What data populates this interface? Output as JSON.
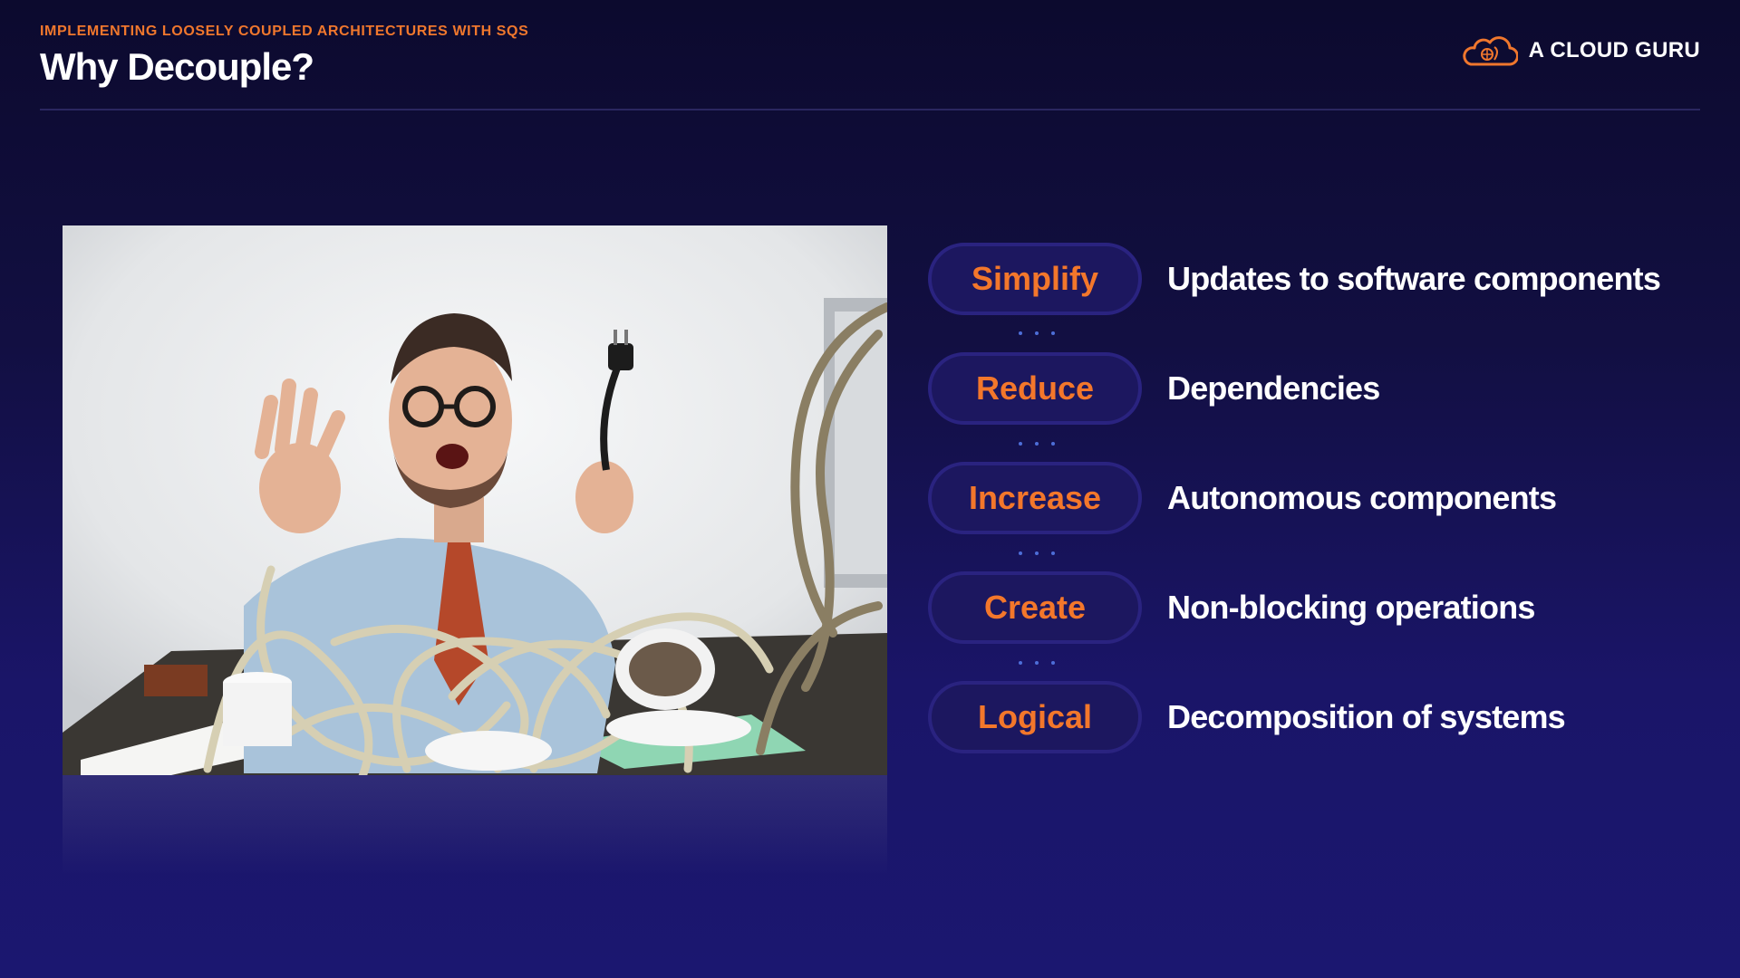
{
  "header": {
    "subtitle": "IMPLEMENTING LOOSELY COUPLED ARCHITECTURES WITH SQS",
    "title": "Why Decouple?",
    "brand": "A CLOUD GURU"
  },
  "colors": {
    "accent": "#f0772d",
    "background": "#120f42",
    "pill_fill": "#1c175f",
    "pill_border": "#2a2380",
    "connector_dots": "#4d6ed8"
  },
  "icons": {
    "brand_logo": "cloud-logo-icon"
  },
  "image": {
    "subject": "stressed-man-tangled-cables-photo"
  },
  "items": [
    {
      "keyword": "Simplify",
      "description": "Updates to software components"
    },
    {
      "keyword": "Reduce",
      "description": "Dependencies"
    },
    {
      "keyword": "Increase",
      "description": "Autonomous components"
    },
    {
      "keyword": "Create",
      "description": "Non-blocking operations"
    },
    {
      "keyword": "Logical",
      "description": "Decomposition of systems"
    }
  ]
}
